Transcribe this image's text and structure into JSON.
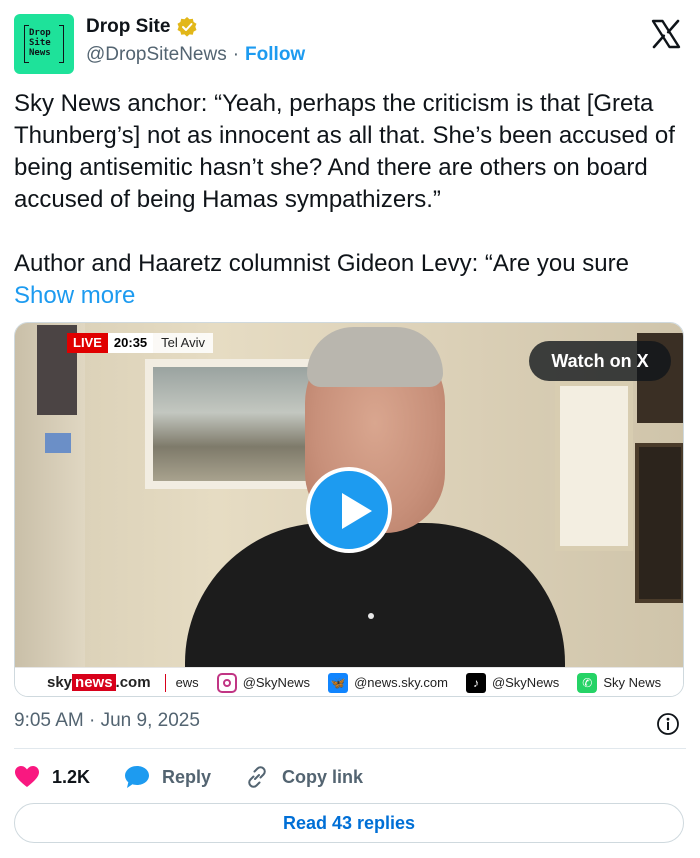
{
  "author": {
    "display_name": "Drop Site",
    "handle": "@DropSiteNews",
    "separator": "·",
    "follow_label": "Follow",
    "avatar_text": "Drop\nSite\nNews",
    "avatar_color": "#1ee29a",
    "verified_icon": "verified-badge-icon"
  },
  "platform_logo": "x-logo-icon",
  "tweet": {
    "text": "Sky News anchor: “Yeah, perhaps the criticism is that [Greta Thunberg’s] not as innocent as all that. She’s been accused of being antisemitic hasn’t she? And there are others on board accused of being Hamas sympathizers.”\n\nAuthor and Haaretz columnist Gideon Levy: “Are you sure",
    "show_more_label": "Show more"
  },
  "media": {
    "live_label": "LIVE",
    "live_time": "20:35",
    "live_location": "Tel Aviv",
    "watch_label": "Watch on X",
    "play_icon": "play-icon",
    "ticker": {
      "brand_sky": "sky",
      "brand_news": "news",
      "brand_com": ".com",
      "partial": "ews",
      "instagram": "@SkyNews",
      "bluesky": "@news.sky.com",
      "tiktok": "@SkyNews",
      "whatsapp": "Sky News"
    }
  },
  "timestamp": "9:05 AM · Jun 9, 2025",
  "actions": {
    "like_count": "1.2K",
    "reply_label": "Reply",
    "copy_link_label": "Copy link"
  },
  "read_replies_label": "Read 43 replies",
  "colors": {
    "accent": "#1d9bf0",
    "like": "#f91880",
    "live_red": "#e00000"
  }
}
